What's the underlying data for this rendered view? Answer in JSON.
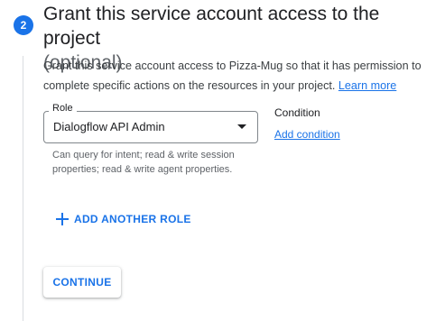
{
  "step": {
    "number": "2",
    "title": "Grant this service account access to the project",
    "optional_label": "(optional)"
  },
  "description": {
    "text": "Grant this service account access to Pizza-Mug so that it has permission to complete specific actions on the resources in your project. ",
    "learn_more_label": "Learn more"
  },
  "role": {
    "label": "Role",
    "selected_value": "Dialogflow API Admin",
    "hint": "Can query for intent; read & write session properties; read & write agent properties."
  },
  "condition": {
    "title": "Condition",
    "add_label": "Add condition"
  },
  "actions": {
    "add_role_label": "ADD ANOTHER ROLE",
    "continue_label": "CONTINUE"
  },
  "colors": {
    "accent": "#1a73e8",
    "text_primary": "#202124",
    "text_secondary": "#5f6368"
  }
}
